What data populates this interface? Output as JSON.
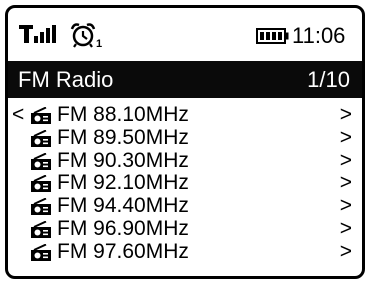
{
  "status": {
    "signal_icon": "signal-strength-icon",
    "alarm_icon": "alarm-clock-icon",
    "alarm_number": "1",
    "battery_icon": "battery-full-icon",
    "time": "11:06"
  },
  "title": {
    "text": "FM Radio",
    "position": "1/10"
  },
  "back_glyph": "<",
  "list": {
    "item_icon": "radio-icon",
    "items": [
      {
        "label": "FM 88.10MHz",
        "arrow": ">"
      },
      {
        "label": "FM 89.50MHz",
        "arrow": ">"
      },
      {
        "label": "FM 90.30MHz",
        "arrow": ">"
      },
      {
        "label": "FM 92.10MHz",
        "arrow": ">"
      },
      {
        "label": "FM 94.40MHz",
        "arrow": ">"
      },
      {
        "label": "FM 96.90MHz",
        "arrow": ">"
      },
      {
        "label": "FM 97.60MHz",
        "arrow": ">"
      }
    ]
  },
  "colors": {
    "title_bar_bg": "#0a0a0a",
    "title_bar_text": "#ffffff",
    "screen_bg": "#ffffff",
    "text": "#000000"
  }
}
